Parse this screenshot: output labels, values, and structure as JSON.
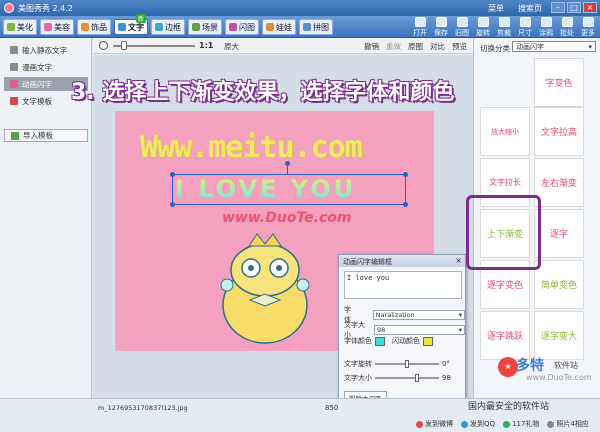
{
  "app": {
    "title": "美图秀秀 2.4.2"
  },
  "topmenu": [
    "菜单",
    "搜索页"
  ],
  "tabs": [
    {
      "label": "美化",
      "color": "#7fb53a"
    },
    {
      "label": "美容",
      "color": "#e76aa0"
    },
    {
      "label": "饰品",
      "color": "#f08d2e"
    },
    {
      "label": "文字",
      "color": "#3d8fd8"
    },
    {
      "label": "边框",
      "color": "#45a5c8"
    },
    {
      "label": "场景",
      "color": "#6c9a3e"
    },
    {
      "label": "闪图",
      "color": "#c94f9c"
    },
    {
      "label": "娃娃",
      "color": "#e28b3d"
    },
    {
      "label": "拼图",
      "color": "#5a8fd6"
    }
  ],
  "new_badge": "新",
  "right_tools": [
    "打开",
    "保存",
    "旧图",
    "旋转",
    "剪裁",
    "尺寸",
    "涂鸦",
    "批处",
    "更多"
  ],
  "sidebar": {
    "items": [
      {
        "label": "输入静态文字",
        "icon": "text-icon",
        "color": "#8a8a8a"
      },
      {
        "label": "漫画文字",
        "icon": "comic-text-icon",
        "color": "#8a8a8a"
      },
      {
        "label": "动画闪字",
        "icon": "flash-text-icon",
        "color": "#e05a8a"
      },
      {
        "label": "文字模板",
        "icon": "template-icon",
        "color": "#d84848"
      }
    ],
    "import_label": "导入模板"
  },
  "zoom": {
    "ratio": "1:1",
    "original": "原大",
    "undo": "撤销",
    "redo": "重做",
    "original_pic": "原图",
    "compare": "对比",
    "preview": "预览"
  },
  "headline": "3. 选择上下渐变效果，选择字体和颜色",
  "canvas": {
    "wordart": "Www.meitu.com",
    "love": "I LOVE YOU",
    "watermark": "www.DuoTe.com"
  },
  "editor": {
    "title": "动画闪字编辑框",
    "text": "I love you",
    "font_label": "字体",
    "font_value": "Naralization",
    "size_label": "文字大小",
    "size_value": "98",
    "color_label": "字体颜色",
    "flash_color_label": "闪动颜色",
    "text_color": "#40d8e0",
    "flash_color": "#f2e03c",
    "rotate_label": "文字旋转",
    "rotate_value": "0°",
    "size2_label": "文字大小",
    "size2_value": "98",
    "delete_label": "删除本闪字"
  },
  "right_panel": {
    "label": "切换分类",
    "category": "动画闪字",
    "cells": [
      {
        "label": "放大缩小",
        "color": "#e24b6d"
      },
      {
        "label": "文字拉高",
        "color": "#e24b6d"
      },
      {
        "label": "文字拉长",
        "color": "#e24b6d"
      },
      {
        "label": "左右渐变",
        "color": "#e24b6d"
      },
      {
        "label": "上下渐变",
        "color": "#7dbb2e"
      },
      {
        "label": "逐字",
        "color": "#e24b6d"
      },
      {
        "label": "逐字变色",
        "color": "#e24b6d"
      },
      {
        "label": "简单变色",
        "color": "#7dbb2e"
      },
      {
        "label": "逐字跳跃",
        "color": "#e24b6d"
      },
      {
        "label": "逐字变大",
        "color": "#7dbb2e"
      }
    ],
    "top_cell_partial": "字变色"
  },
  "statusbar": {
    "filename": "m_1276953170837l123.jpg",
    "dims": "850",
    "links": [
      "发到微博",
      "发到QQ",
      "117礼物",
      "照片4相应"
    ]
  },
  "logo": {
    "text": "多特",
    "sub": "软件站",
    "url": "www.DuoTe.com",
    "tagline": "国内最安全的软件站"
  }
}
